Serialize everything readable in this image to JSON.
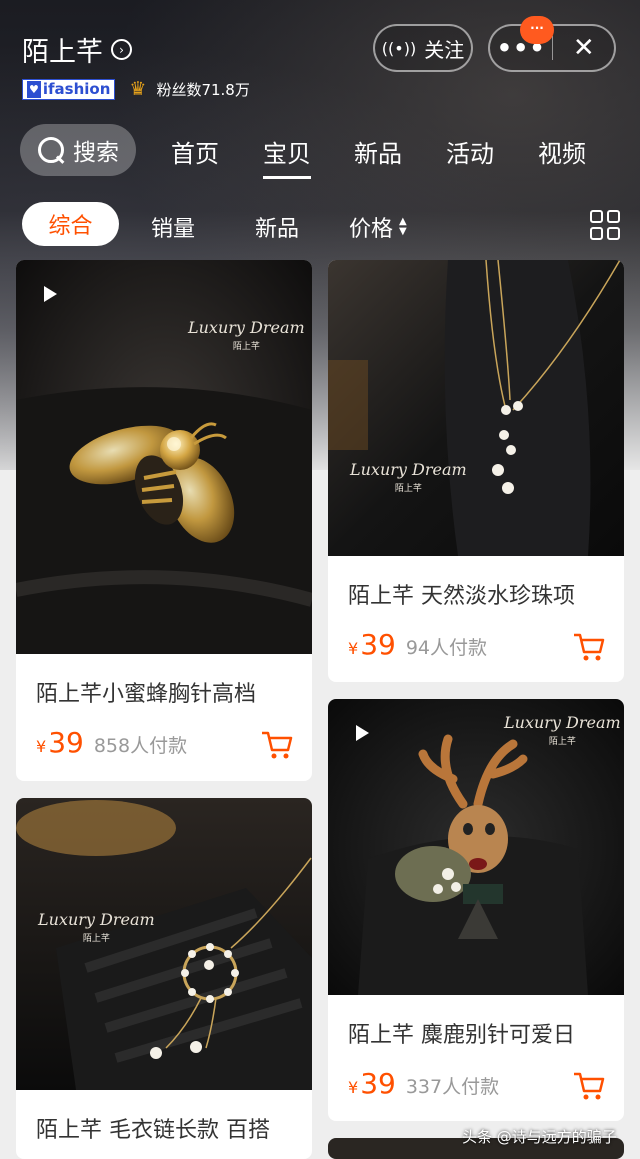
{
  "header": {
    "shop_name": "陌上芊",
    "shop_arrow": "›",
    "badge_ifashion": "ifashion",
    "fans": "粉丝数71.8万",
    "follow_label": "关注",
    "more_label": "•••",
    "close_label": "✕",
    "notify_badge": "···"
  },
  "nav": {
    "search_label": "搜索",
    "tabs": [
      "首页",
      "宝贝",
      "新品",
      "活动",
      "视频"
    ],
    "active_tab": "宝贝"
  },
  "filters": {
    "items": [
      "综合",
      "销量",
      "新品",
      "价格"
    ],
    "active": "综合"
  },
  "brand_watermark": {
    "main": "Luxury Dream",
    "sub": "陌上芊"
  },
  "products": [
    {
      "title": "陌上芊小蜜蜂胸针高档",
      "currency": "¥",
      "price": "39",
      "sold": "858人付款",
      "has_video": true
    },
    {
      "title": "陌上芊 天然淡水珍珠项",
      "currency": "¥",
      "price": "39",
      "sold": "94人付款",
      "has_video": false
    },
    {
      "title": "陌上芊 毛衣链长款 百搭",
      "currency": "¥",
      "price": "",
      "sold": "",
      "has_video": false
    },
    {
      "title": "陌上芊 麋鹿别针可爱日",
      "currency": "¥",
      "price": "39",
      "sold": "337人付款",
      "has_video": true
    }
  ],
  "colors": {
    "accent": "#ff5000",
    "header_dark": "#1b1c22"
  },
  "footer_watermark": "头条 @诗与远方的骗子"
}
